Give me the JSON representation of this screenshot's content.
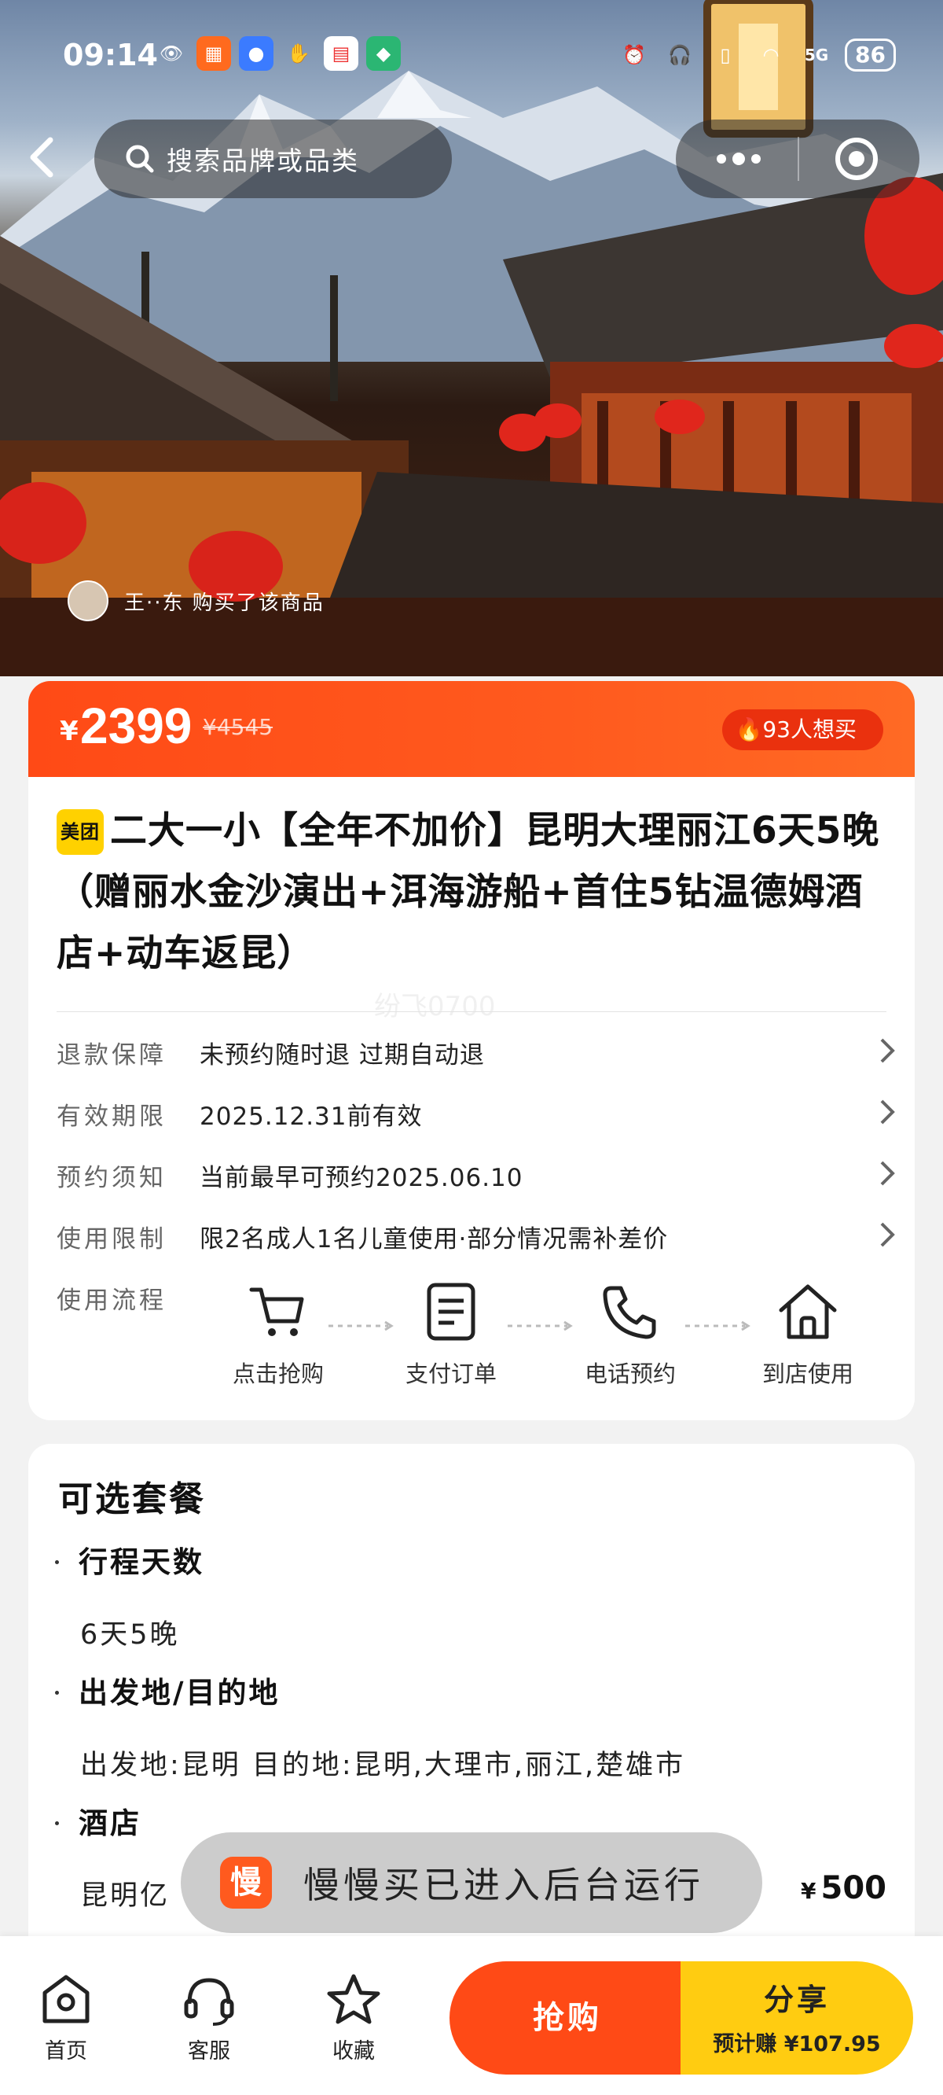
{
  "status_bar": {
    "time": "09:14",
    "network": "5G",
    "battery": "86"
  },
  "nav": {
    "search_placeholder": "搜索品牌或品类"
  },
  "hero": {
    "recent_buyer": "王··东 购买了该商品"
  },
  "price": {
    "currency": "¥",
    "current": "2399",
    "original": "¥4545",
    "want_count": "93人想买"
  },
  "product": {
    "badge": "美团",
    "title": "二大一小【全年不加价】昆明大理丽江6天5晚（赠丽水金沙演出+洱海游船+首住5钻温德姆酒店+动车返昆）",
    "watermark": "纷飞0700",
    "info": [
      {
        "label": "退款保障",
        "value": "未预约随时退 过期自动退"
      },
      {
        "label": "有效期限",
        "value": "2025.12.31前有效"
      },
      {
        "label": "预约须知",
        "value": "当前最早可预约2025.06.10"
      },
      {
        "label": "使用限制",
        "value": "限2名成人1名儿童使用·部分情况需补差价"
      }
    ],
    "flow_label": "使用流程",
    "flow_steps": [
      "点击抢购",
      "支付订单",
      "电话预约",
      "到店使用"
    ]
  },
  "package": {
    "title": "可选套餐",
    "sections": [
      {
        "heading": "行程天数",
        "value": "6天5晚"
      },
      {
        "heading": "出发地/目的地",
        "value": "出发地:昆明 目的地:昆明,大理市,丽江,楚雄市"
      },
      {
        "heading": "酒店",
        "value": "昆明亿"
      }
    ],
    "hotel_price": "500",
    "hotel_currency": "¥"
  },
  "toast": {
    "icon_text": "慢",
    "message": "慢慢买已进入后台运行"
  },
  "bottom_bar": {
    "tabs": [
      "首页",
      "客服",
      "收藏"
    ],
    "buy_label": "抢购",
    "share_label": "分享",
    "share_earn": "预计赚 ¥107.95"
  },
  "colors": {
    "accent": "#ff4a16",
    "share": "#ffcc11",
    "meituan": "#ffd100"
  }
}
